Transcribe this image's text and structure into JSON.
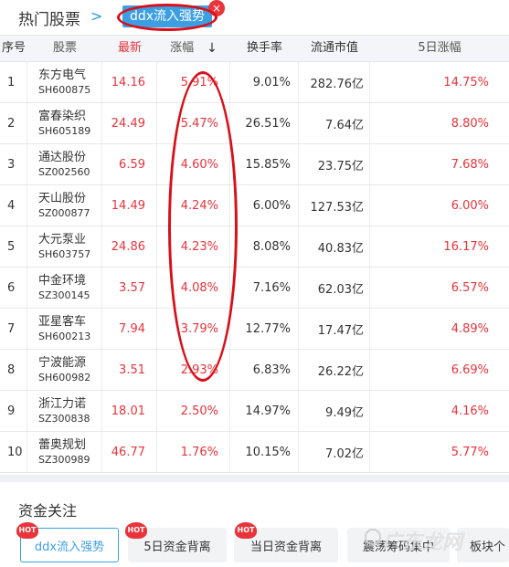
{
  "header": {
    "title": "热门股票",
    "chevron": ">",
    "tag": "ddx流入强势",
    "tag_close": "×"
  },
  "table": {
    "columns": [
      "序号",
      "股票",
      "最新",
      "涨幅",
      "换手率",
      "流通市值",
      "5日涨幅"
    ],
    "sort_arrow": "↓",
    "rows": [
      {
        "idx": "1",
        "name": "东方电气",
        "code": "SH600875",
        "price": "14.16",
        "chg": "5.91%",
        "turnover": "9.01%",
        "cap": "282.76亿",
        "chg5": "14.75%"
      },
      {
        "idx": "2",
        "name": "富春染织",
        "code": "SH605189",
        "price": "24.49",
        "chg": "5.47%",
        "turnover": "26.51%",
        "cap": "7.64亿",
        "chg5": "8.80%"
      },
      {
        "idx": "3",
        "name": "通达股份",
        "code": "SZ002560",
        "price": "6.59",
        "chg": "4.60%",
        "turnover": "15.85%",
        "cap": "23.75亿",
        "chg5": "7.68%"
      },
      {
        "idx": "4",
        "name": "天山股份",
        "code": "SZ000877",
        "price": "14.49",
        "chg": "4.24%",
        "turnover": "6.00%",
        "cap": "127.53亿",
        "chg5": "6.00%"
      },
      {
        "idx": "5",
        "name": "大元泵业",
        "code": "SH603757",
        "price": "24.86",
        "chg": "4.23%",
        "turnover": "8.08%",
        "cap": "40.83亿",
        "chg5": "16.17%"
      },
      {
        "idx": "6",
        "name": "中金环境",
        "code": "SZ300145",
        "price": "3.57",
        "chg": "4.08%",
        "turnover": "7.16%",
        "cap": "62.03亿",
        "chg5": "6.57%"
      },
      {
        "idx": "7",
        "name": "亚星客车",
        "code": "SH600213",
        "price": "7.94",
        "chg": "3.79%",
        "turnover": "12.77%",
        "cap": "17.47亿",
        "chg5": "4.89%"
      },
      {
        "idx": "8",
        "name": "宁波能源",
        "code": "SH600982",
        "price": "3.51",
        "chg": "2.93%",
        "turnover": "6.83%",
        "cap": "26.22亿",
        "chg5": "6.69%"
      },
      {
        "idx": "9",
        "name": "浙江力诺",
        "code": "SZ300838",
        "price": "18.01",
        "chg": "2.50%",
        "turnover": "14.97%",
        "cap": "9.49亿",
        "chg5": "4.16%"
      },
      {
        "idx": "10",
        "name": "蕾奥规划",
        "code": "SZ300989",
        "price": "46.77",
        "chg": "1.76%",
        "turnover": "10.15%",
        "cap": "7.02亿",
        "chg5": "5.77%"
      }
    ]
  },
  "funds": {
    "title": "资金关注",
    "hot_label": "HOT",
    "buttons": [
      "ddx流入强势",
      "5日资金背离",
      "当日资金背离",
      "震荡筹码集中",
      "板块个"
    ]
  },
  "watermark": "广东龙网",
  "colors": {
    "accent": "#3d9fe3",
    "up_red": "#e8343b",
    "annotation": "#d8101a"
  }
}
